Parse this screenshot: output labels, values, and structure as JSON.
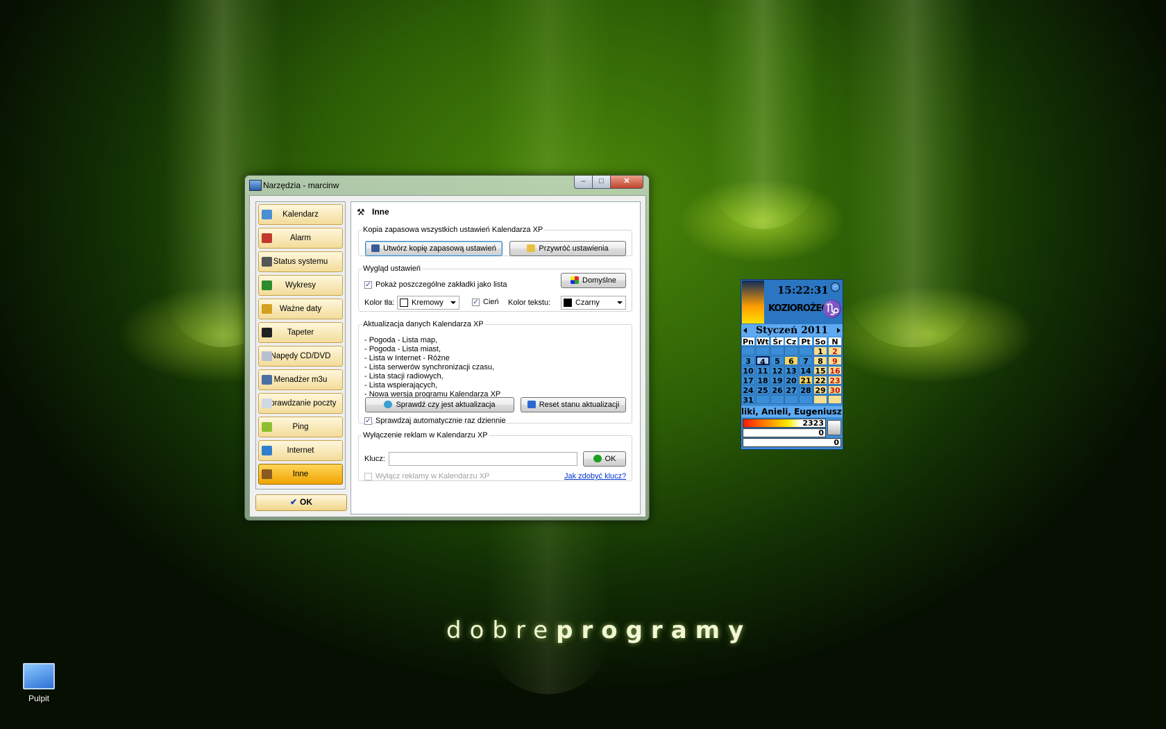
{
  "window": {
    "title": "Narzędzia - marcinw",
    "min": "–",
    "max": "□",
    "close": "✕"
  },
  "nav": {
    "items": [
      {
        "label": "Kalendarz",
        "icon": "calendar-icon",
        "color": "#4a8fd6"
      },
      {
        "label": "Alarm",
        "icon": "alarm-clock-icon",
        "color": "#c0392b"
      },
      {
        "label": "Status systemu",
        "icon": "tools-icon",
        "color": "#555555"
      },
      {
        "label": "Wykresy",
        "icon": "bar-chart-icon",
        "color": "#2e8b2e"
      },
      {
        "label": "Ważne daty",
        "icon": "calendar-page-icon",
        "color": "#d4a020"
      },
      {
        "label": "Tapeter",
        "icon": "monitor-icon",
        "color": "#222222"
      },
      {
        "label": "Napędy CD/DVD",
        "icon": "cd-icon",
        "color": "#b8c0d0"
      },
      {
        "label": "Menadżer m3u",
        "icon": "playlist-icon",
        "color": "#4a6fa5"
      },
      {
        "label": "Sprawdzanie poczty",
        "icon": "envelope-icon",
        "color": "#cfd8e0"
      },
      {
        "label": "Ping",
        "icon": "pencil-icon",
        "color": "#8fbf2f"
      },
      {
        "label": "Internet",
        "icon": "globe-icon",
        "color": "#2f7fcf"
      },
      {
        "label": "Inne",
        "icon": "hammer-icon",
        "color": "#8a5a20"
      }
    ],
    "active_index": 11,
    "ok_label": "OK",
    "ok_glyph": "✔"
  },
  "panel": {
    "title": "Inne",
    "icon": "⚒",
    "backup": {
      "legend": "Kopia zapasowa wszystkich ustawień Kalendarza XP",
      "create_label": "Utwórz kopię zapasową ustawień",
      "restore_label": "Przywróć ustawienia"
    },
    "appearance": {
      "legend": "Wygląd ustawień",
      "show_tabs_label": "Pokaż poszczególne zakładki jako lista",
      "show_tabs_checked": "✓",
      "defaults_label": "Domyślne",
      "bg_color_label": "Kolor tła:",
      "bg_color_value": "Kremowy",
      "bg_swatch": "#ffffff",
      "shadow_label": "Cień",
      "shadow_checked": "✓",
      "text_color_label": "Kolor tekstu:",
      "text_color_value": "Czarny",
      "text_swatch": "#000000"
    },
    "update": {
      "legend": "Aktualizacja danych Kalendarza XP",
      "lines": [
        "- Pogoda - Lista map,",
        "- Pogoda - Lista miast,",
        "- Lista w Internet - Różne",
        "- Lista serwerów synchronizacji czasu,",
        "- Lista stacji radiowych,",
        "- Lista wspierających,",
        "- Nowa wersja programu Kalendarza XP"
      ],
      "check_label": "Sprawdź czy jest aktualizacja",
      "reset_label": "Reset stanu aktualizacji",
      "auto_label": "Sprawdzaj automatycznie raz dziennie",
      "auto_checked": "✓"
    },
    "ads": {
      "legend": "Wyłączenie reklam w Kalendarzu XP",
      "key_label": "Klucz:",
      "key_value": "",
      "ok_label": "OK",
      "disable_label": "Wyłącz reklamy w Kalendarzu XP",
      "how_link": "Jak zdobyć klucz?"
    }
  },
  "calendar": {
    "time": "15:22:31",
    "zodiac": "KOZIOROŻEC",
    "zodiac_symbol": "♑",
    "month": "Styczeń 2011",
    "weekdays": [
      "Pn",
      "Wt",
      "Śr",
      "Cz",
      "Pt",
      "So",
      "N"
    ],
    "rows": [
      [
        "",
        "",
        "",
        "",
        "",
        "1",
        "2"
      ],
      [
        "3",
        "4",
        "5",
        "6",
        "7",
        "8",
        "9"
      ],
      [
        "10",
        "11",
        "12",
        "13",
        "14",
        "15",
        "16"
      ],
      [
        "17",
        "18",
        "19",
        "20",
        "21",
        "22",
        "23"
      ],
      [
        "24",
        "25",
        "26",
        "27",
        "28",
        "29",
        "30"
      ],
      [
        "31",
        "",
        "",
        "",
        "",
        "",
        ""
      ]
    ],
    "today": "4",
    "highlighted": [
      "6",
      "21"
    ],
    "names": "liki, Anieli, Eugeniusz",
    "stat1": "2323",
    "stat2": "0",
    "stat3": "0"
  },
  "desktop": {
    "brand_light": "dobre",
    "brand_bold": "programy",
    "icon_label": "Pulpit"
  }
}
